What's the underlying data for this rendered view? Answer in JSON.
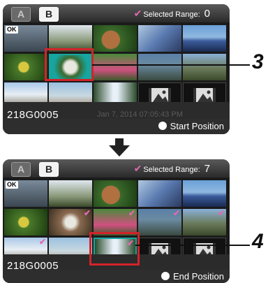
{
  "tabs": [
    "A",
    "B"
  ],
  "top_screen": {
    "selected_range_label": "Selected Range:",
    "selected_range_value": "0",
    "clip_name": "218G0005",
    "date_text": "Jan 7, 2014 07:05:43 PM",
    "status_label": "Start Position",
    "ok_badge": "OK"
  },
  "bottom_screen": {
    "selected_range_label": "Selected Range:",
    "selected_range_value": "7",
    "clip_name": "218G0005",
    "status_label": "End Position",
    "ok_badge": "OK"
  },
  "callouts": {
    "top": "3",
    "bottom": "4"
  },
  "colors": {
    "accent_check": "#e06ab0",
    "highlight": "#d2232a",
    "focus": "#17a5a0"
  },
  "icons": [
    "check-icon",
    "down-arrow-icon",
    "movie-file-icon"
  ]
}
